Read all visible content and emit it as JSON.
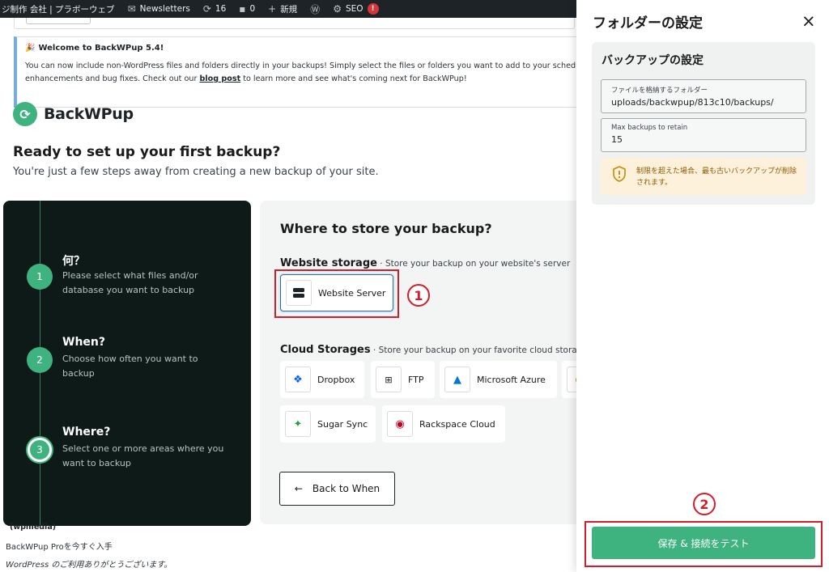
{
  "admin_bar": {
    "site_name": "ジ制作 会社 | プラボーウェブ",
    "newsletters": "Newsletters",
    "updates_count": "16",
    "comments_count": "0",
    "new_label": "新規",
    "seo_label": "SEO",
    "seo_badge": "!"
  },
  "notice": {
    "emoji": "🎉",
    "title": "Welcome to BackWPup 5.4!",
    "line1": "You can now include non-WordPress files and folders directly in your backups! Simply select the files or folders you want to add to your scheduled o",
    "line2_before": "enhancements and bug fixes. Check out our ",
    "link": "blog post",
    "line2_after": " to learn more and see what's coming next for BackWPup!"
  },
  "brand": {
    "name": "BackWPup"
  },
  "intro": {
    "title": "Ready to set up your first backup?",
    "subtitle": "You're just a few steps away from creating a new backup of your site."
  },
  "steps": [
    {
      "number": "1",
      "title": "何？",
      "description": "Please select what files and/or database you want to backup"
    },
    {
      "number": "2",
      "title": "When?",
      "description": "Choose how often you want to backup"
    },
    {
      "number": "3",
      "title": "Where?",
      "description": "Select one or more areas where you want to backup"
    }
  ],
  "storage": {
    "title": "Where to store your backup?",
    "website_heading": "Website storage",
    "website_note": " · Store your backup on your website's server",
    "website_server": "Website Server",
    "cloud_heading": "Cloud Storages",
    "cloud_note": " · Store your backup on your favorite cloud storage",
    "cloud_items": [
      "Dropbox",
      "FTP",
      "Microsoft Azure",
      "Sugar Sync",
      "Rackspace Cloud"
    ],
    "back_button": "Back to When"
  },
  "footer": {
    "wpmedia": "(wpmedia)",
    "pro": "BackWPup Proを今すぐ入手",
    "thanks": "WordPress のご利用ありがとうございます。"
  },
  "annotations": {
    "one": "1",
    "two": "2"
  },
  "panel": {
    "title": "フォルダーの設定",
    "close": "×",
    "card_title": "バックアップの設定",
    "folder_label": "ファイルを格納するフォルダー",
    "folder_value": "uploads/backwpup/813c10/backups/",
    "max_label": "Max backups to retain",
    "max_value": "15",
    "warning": "制限を超えた場合、最も古いバックアップが削除されます。",
    "save_button": "保存 & 接続をテスト"
  },
  "colors": {
    "accent": "#3fb37f",
    "annotation": "#d21e2b",
    "selected_border": "#2c6aa8",
    "steps_bg": "#0d1a17"
  }
}
